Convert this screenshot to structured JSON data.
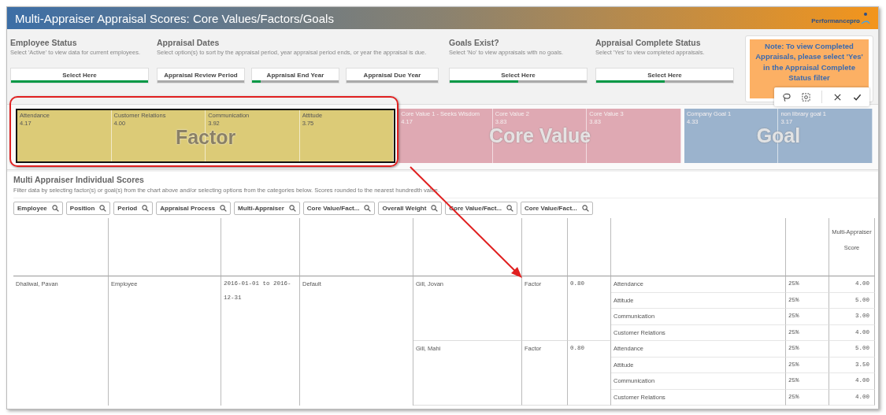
{
  "title_bar": {
    "title": "Multi-Appraiser Appraisal Scores: Core Values/Factors/Goals",
    "logo": {
      "name": "Performance",
      "suffix": "pro"
    }
  },
  "filters": [
    {
      "title": "Employee Status",
      "description": "Select 'Active' to view data for current employees.",
      "dropdowns": [
        {
          "label": "Select Here",
          "level": 1
        }
      ]
    },
    {
      "title": "Appraisal Dates",
      "description": "Select option(s) to sort by the appraisal period, year appraisal period ends, or year the appraisal is due.",
      "dropdowns": [
        {
          "label": "Appraisal Review Period"
        },
        {
          "label": "Appraisal End Year",
          "level": 0.1
        },
        {
          "label": "Appraisal Due Year"
        }
      ]
    },
    {
      "title": "Goals Exist?",
      "description": "Select 'No' to view appraisals with no goals.",
      "dropdowns": [
        {
          "label": "Select Here",
          "level": 0.5
        }
      ]
    },
    {
      "title": "Appraisal Complete Status",
      "description": "Select 'Yes' to view completed appraisals.",
      "dropdowns": [
        {
          "label": "Select Here",
          "level": 0.5
        }
      ]
    }
  ],
  "note": "Note: To view Completed Appraisals, please select 'Yes' in the Appraisal Complete Status filter",
  "selection_toolbar": {
    "visible": true
  },
  "treemap": {
    "groups": [
      {
        "label": "Factor",
        "selected": true,
        "color": "#dccb77",
        "tiles": [
          {
            "label": "Attendance",
            "value": "4.17"
          },
          {
            "label": "Customer Relations",
            "value": "4.00"
          },
          {
            "label": "Communication",
            "value": "3.92"
          },
          {
            "label": "Attitude",
            "value": "3.75"
          }
        ]
      },
      {
        "label": "Core Value",
        "selected": false,
        "color": "#dfa9b3",
        "tiles": [
          {
            "label": "Core Value 1 - Seeks Wisdom",
            "value": "4.17"
          },
          {
            "label": "Core Value 2",
            "value": "3.83"
          },
          {
            "label": "Core Value 3",
            "value": "3.83"
          }
        ]
      },
      {
        "label": "Goal",
        "selected": false,
        "color": "#9bb3cd",
        "tiles": [
          {
            "label": "Company Goal 1",
            "value": "4.33"
          },
          {
            "label": "non library goal 1",
            "value": "3.17"
          }
        ]
      }
    ]
  },
  "callout": {
    "outline": true,
    "arrow": true
  },
  "table": {
    "title": "Multi Appraiser Individual Scores",
    "description": "Filter data by selecting factor(s) or goal(s) from the chart above and/or selecting options from the categories below. Scores rounded to the nearest hundredth value.",
    "filters": [
      "Employee",
      "Position",
      "Period",
      "Appraisal Process",
      "Multi-Appraiser",
      "Core Value/Fact...",
      "Overall Weight",
      "Core Value/Fact...",
      "Core Value/Fact..."
    ],
    "score_header": "Multi-Appraiser Score",
    "rows": [
      {
        "employee": "Dhaliwal, Pavan",
        "position": "Employee",
        "period": "2016-01-01 to 2016-12-31",
        "process": "Default",
        "appraisers": [
          {
            "name": "Gill, Jovan",
            "type": "Factor",
            "weight": "0.80",
            "items": [
              {
                "name": "Attendance",
                "weight": "25%",
                "score": "4.00"
              },
              {
                "name": "Attitude",
                "weight": "25%",
                "score": "5.00"
              },
              {
                "name": "Communication",
                "weight": "25%",
                "score": "3.00"
              },
              {
                "name": "Customer Relations",
                "weight": "25%",
                "score": "4.00"
              }
            ]
          },
          {
            "name": "Gill, Mahi",
            "type": "Factor",
            "weight": "0.80",
            "items": [
              {
                "name": "Attendance",
                "weight": "25%",
                "score": "5.00"
              },
              {
                "name": "Attitude",
                "weight": "25%",
                "score": "3.50"
              },
              {
                "name": "Communication",
                "weight": "25%",
                "score": "4.00"
              },
              {
                "name": "Customer Relations",
                "weight": "25%",
                "score": "4.00"
              }
            ]
          }
        ]
      }
    ]
  }
}
